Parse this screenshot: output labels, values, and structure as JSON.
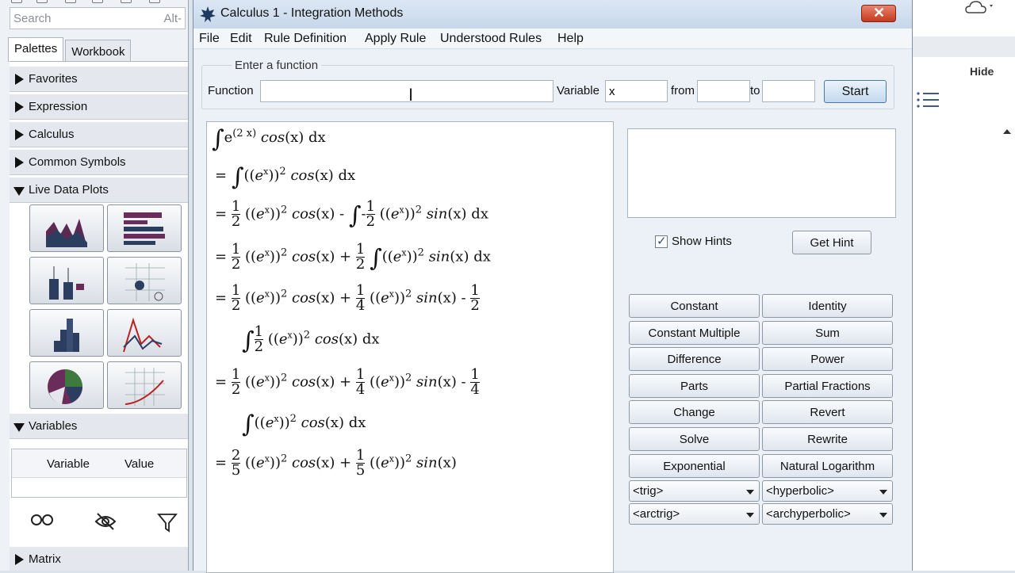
{
  "palette": {
    "search_placeholder": "Search",
    "search_shortcut": "Alt-",
    "tabs": [
      "Palettes",
      "Workbook"
    ],
    "sections": {
      "favorites": "Favorites",
      "expression": "Expression",
      "calculus": "Calculus",
      "common_symbols": "Common Symbols",
      "live_data_plots": "Live Data Plots",
      "variables": "Variables",
      "matrix": "Matrix"
    },
    "variables_table": {
      "col1": "Variable",
      "col2": "Value"
    },
    "plot_icons": [
      "area-chart-icon",
      "bar-chart-horizontal-icon",
      "box-plot-icon",
      "scatter-plot-icon",
      "histogram-icon",
      "line-chart-icon",
      "pie-chart-icon",
      "curve-plot-icon"
    ]
  },
  "background_app": {
    "hide_label": "Hide"
  },
  "window": {
    "title": "Calculus 1 - Integration Methods",
    "close_label": "✕",
    "menu": [
      "File",
      "Edit",
      "Rule Definition",
      "Apply Rule",
      "Understood Rules",
      "Help"
    ]
  },
  "function_entry": {
    "group_label": "Enter a function",
    "function_label": "Function",
    "function_value": "",
    "variable_label": "Variable",
    "variable_value": "x",
    "from_label": "from",
    "from_value": "",
    "to_label": "to",
    "to_value": "",
    "start_label": "Start"
  },
  "hints": {
    "show_hints_label": "Show Hints",
    "show_hints_checked": true,
    "get_hint_label": "Get Hint"
  },
  "rules": [
    [
      "Constant",
      "Identity"
    ],
    [
      "Constant Multiple",
      "Sum"
    ],
    [
      "Difference",
      "Power"
    ],
    [
      "Parts",
      "Partial Fractions"
    ],
    [
      "Change",
      "Revert"
    ],
    [
      "Solve",
      "Rewrite"
    ],
    [
      "Exponential",
      "Natural Logarithm"
    ]
  ],
  "dropdowns": [
    [
      "<trig>",
      "<hyperbolic>"
    ],
    [
      "<arctrig>",
      "<archyperbolic>"
    ]
  ],
  "derivation": {
    "dx": "dx",
    "cos": "cos",
    "sin": "sin",
    "x": "x",
    "e": "e",
    "exp": "(2 x)"
  }
}
